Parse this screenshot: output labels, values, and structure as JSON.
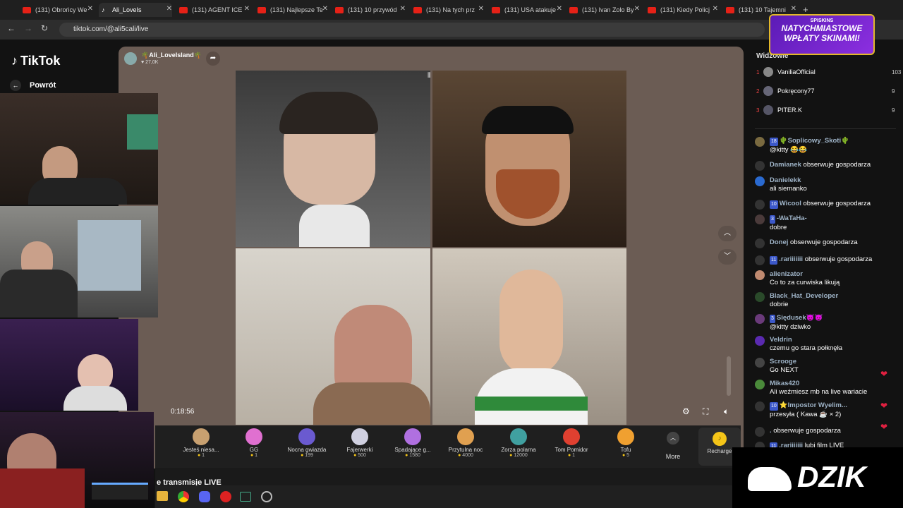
{
  "browser": {
    "tabs": [
      {
        "label": "(131) Obrońcy We",
        "kind": "yt"
      },
      {
        "label": "Ali_LoveIs",
        "kind": "tiktok",
        "active": true
      },
      {
        "label": "(131) AGENT ICE",
        "kind": "yt"
      },
      {
        "label": "(131) Najlepsze Te",
        "kind": "yt"
      },
      {
        "label": "(131) 10 przywód",
        "kind": "yt"
      },
      {
        "label": "(131) Na tych prz",
        "kind": "yt"
      },
      {
        "label": "(131) USA atakuje",
        "kind": "yt"
      },
      {
        "label": "(131) Ivan Zolo By",
        "kind": "yt"
      },
      {
        "label": "(131) Kiedy Policj",
        "kind": "yt"
      },
      {
        "label": "(131) 10 Tajemni",
        "kind": "yt"
      }
    ],
    "new_tab": "+",
    "url": "tiktok.com/@ali5cali/live"
  },
  "tiktok": {
    "logo": "TikTok",
    "back_label": "Powrót",
    "host_name": "🌴Ali_LoveIsland🌴",
    "host_likes": "♥ 27,0K",
    "timer": "0:18:56",
    "gifts": [
      {
        "name": "Jesteś niesa...",
        "price": "1",
        "color": "#c8a070"
      },
      {
        "name": "GG",
        "price": "1",
        "color": "#e070d0"
      },
      {
        "name": "Nocna gwiazda",
        "price": "199",
        "color": "#6a5ad0"
      },
      {
        "name": "Fajerwerki",
        "price": "500",
        "color": "#d0d0e0"
      },
      {
        "name": "Spadające g...",
        "price": "1580",
        "color": "#b070e0"
      },
      {
        "name": "Przytulna noc",
        "price": "4000",
        "color": "#e0a050"
      },
      {
        "name": "Zorza polarna",
        "price": "12000",
        "color": "#40a0a0"
      },
      {
        "name": "Tom Pomidor",
        "price": "1",
        "color": "#e04030"
      },
      {
        "name": "Tofu",
        "price": "5",
        "color": "#f0a030"
      }
    ],
    "more_label": "More",
    "recharge_label": "Recharge",
    "below_text": "e transmisje LIVE"
  },
  "chat": {
    "viewers_label": "Widzowie",
    "ranking": [
      {
        "rank": "1",
        "name": "VaniliaOfficial",
        "count": "103"
      },
      {
        "rank": "2",
        "name": "Pokręcony77",
        "count": "9"
      },
      {
        "rank": "3",
        "name": "PITER.K",
        "count": "9"
      }
    ],
    "messages": [
      {
        "badge": "18",
        "user": "🌵Soplicowy_Skoti🌵",
        "text": "@kitty 😂😂"
      },
      {
        "badge": "",
        "user": "Damianek",
        "text": "obserwuje gospodarza",
        "inline": true
      },
      {
        "badge": "",
        "user": "Danielekk",
        "text": "ali siemanko"
      },
      {
        "badge": "10",
        "user": "Wicool",
        "text": "obserwuje gospodarza",
        "inline": true
      },
      {
        "badge": "3",
        "user": "-WaTaHa-",
        "text": "dobre"
      },
      {
        "badge": "",
        "user": "Donej",
        "text": "obserwuje gospodarza",
        "inline": true
      },
      {
        "badge": "11",
        "user": ".rariiiiiii",
        "text": "obserwuje gospodarza",
        "inline": true
      },
      {
        "badge": "",
        "user": "alienizator",
        "text": "Co to za curwiska likują"
      },
      {
        "badge": "",
        "user": "Black_Hat_Developer",
        "text": "dobrie"
      },
      {
        "badge": "3",
        "user": "Siędusek😈😈",
        "text": "@kitty dziwko"
      },
      {
        "badge": "",
        "user": "Veldrin",
        "text": "czemu go stara połknęła"
      },
      {
        "badge": "",
        "user": "Scrooge",
        "text": "Go NEXT"
      },
      {
        "badge": "",
        "user": "Mikas420",
        "text": "Ali weźmiesz mb na live wariacie"
      },
      {
        "badge": "10",
        "user": "⭐Impostor Wyelim...",
        "text": "przesyła ( Kawa ☕ × 2)"
      },
      {
        "badge": "",
        "user": ".",
        "text": "obserwuje gospodarza",
        "inline": true
      },
      {
        "badge": "11",
        "user": ".rariiiiiii",
        "text": "lubi film LIVE",
        "inline": true
      }
    ]
  },
  "overlays": {
    "ad_line1": "NATYCHMIASTOWE",
    "ad_line2": "WPŁATY SKINAMI!",
    "ad_brand": "SPISKINS",
    "dzik": "DZIK"
  }
}
